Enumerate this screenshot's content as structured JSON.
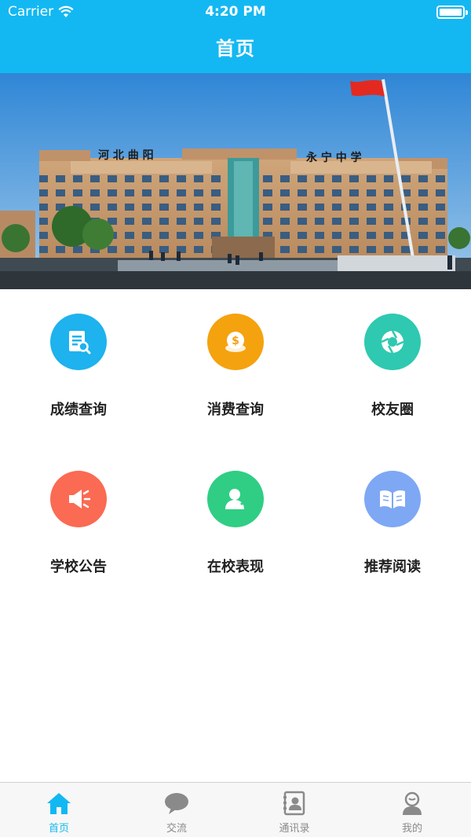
{
  "status_bar": {
    "carrier": "Carrier",
    "time": "4:20 PM",
    "icons": [
      "wifi-icon",
      "battery-icon"
    ]
  },
  "nav": {
    "title": "首页"
  },
  "banner": {
    "sign_left": "河 北 曲 阳",
    "sign_right": "永 宁 中 学"
  },
  "menu": [
    {
      "label": "成绩查询",
      "icon": "report-search-icon",
      "color": "#1eb2ee"
    },
    {
      "label": "消费查询",
      "icon": "coin-icon",
      "color": "#f5a20f"
    },
    {
      "label": "校友圈",
      "icon": "aperture-icon",
      "color": "#2ec9b0"
    },
    {
      "label": "学校公告",
      "icon": "megaphone-icon",
      "color": "#fb6a53"
    },
    {
      "label": "在校表现",
      "icon": "student-icon",
      "color": "#2fce84"
    },
    {
      "label": "推荐阅读",
      "icon": "book-icon",
      "color": "#7ea8f4"
    }
  ],
  "tabs": [
    {
      "label": "首页",
      "icon": "home-icon",
      "active": true
    },
    {
      "label": "交流",
      "icon": "chat-icon",
      "active": false
    },
    {
      "label": "通讯录",
      "icon": "contacts-icon",
      "active": false
    },
    {
      "label": "我的",
      "icon": "profile-icon",
      "active": false
    }
  ],
  "colors": {
    "accent": "#13b8f2",
    "tab_inactive": "#8a8a8a"
  }
}
